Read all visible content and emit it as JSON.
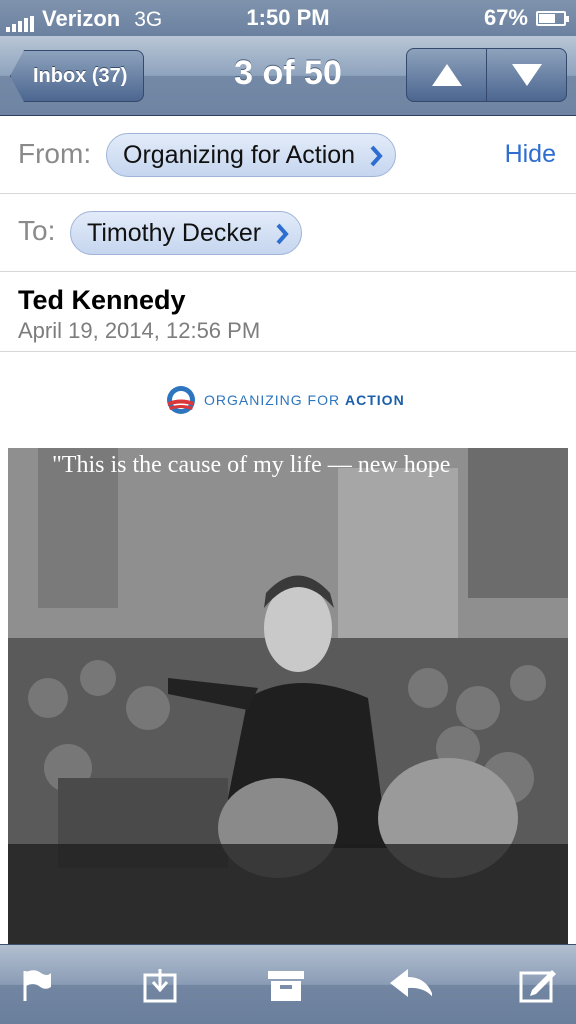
{
  "status_bar": {
    "carrier": "Verizon",
    "network": "3G",
    "time": "1:50 PM",
    "battery": "67%",
    "battery_level": 0.67
  },
  "nav": {
    "back_label": "Inbox (37)",
    "title": "3 of 50"
  },
  "header": {
    "from_label": "From:",
    "from_name": "Organizing for Action",
    "hide_label": "Hide",
    "to_label": "To:",
    "to_name": "Timothy Decker",
    "subject": "Ted Kennedy",
    "date": "April 19, 2014, 12:56 PM"
  },
  "body": {
    "logo_prefix": "ORGANIZING FOR",
    "logo_emphasis": "ACTION",
    "quote": "\"This is the cause of my life — new hope"
  },
  "toolbar": {
    "icons": [
      "flag-icon",
      "move-to-folder-icon",
      "archive-icon",
      "reply-icon",
      "compose-icon"
    ]
  }
}
